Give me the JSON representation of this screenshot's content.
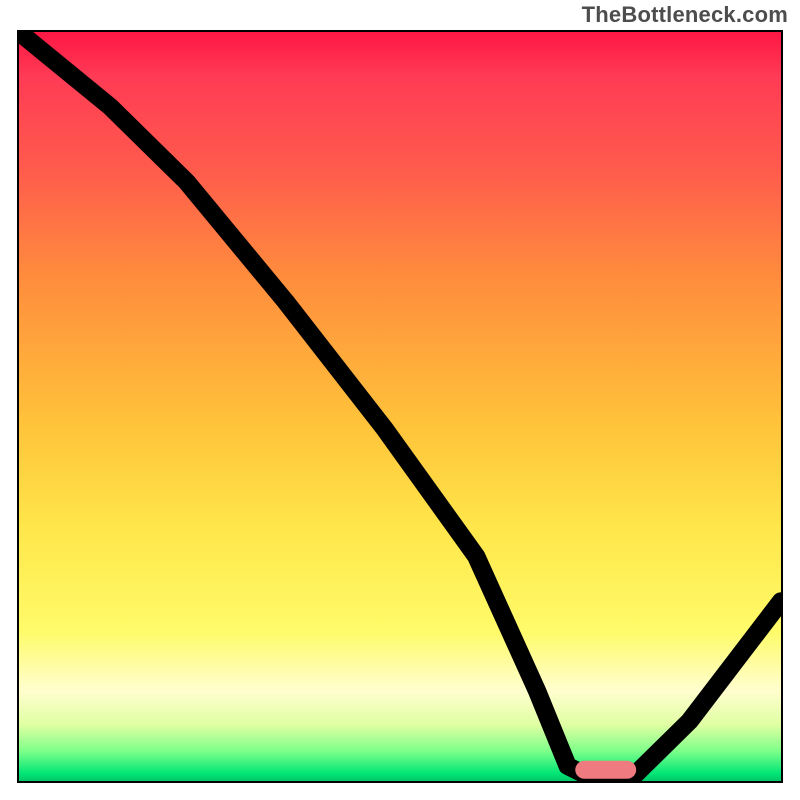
{
  "watermark": "TheBottleneck.com",
  "chart_data": {
    "type": "line",
    "title": "",
    "xlabel": "",
    "ylabel": "",
    "xlim": [
      0,
      100
    ],
    "ylim": [
      0,
      100
    ],
    "legend": false,
    "grid": false,
    "background": "red-to-green-vertical-gradient",
    "series": [
      {
        "name": "bottleneck-curve",
        "x": [
          0,
          12,
          22,
          35,
          48,
          60,
          68,
          72,
          76,
          80,
          88,
          100
        ],
        "y": [
          100,
          90,
          80,
          64,
          47,
          30,
          12,
          2,
          0,
          0,
          8,
          24
        ],
        "color": "#000000"
      }
    ],
    "marker": {
      "name": "optimal-range",
      "shape": "rounded-bar",
      "color": "#ef7a80",
      "x_center": 77,
      "y": 1.5,
      "width_pct": 8,
      "height_pct": 2.4
    }
  }
}
